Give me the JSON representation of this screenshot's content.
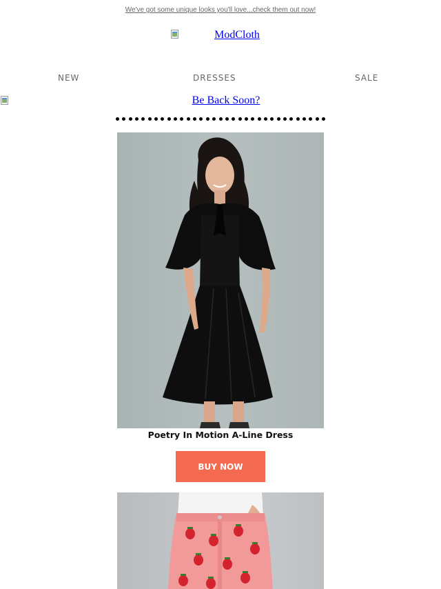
{
  "preheader": {
    "text": "We've got some unique looks you'll love...check them out now!"
  },
  "logo": {
    "alt": "ModCloth"
  },
  "nav": {
    "items": [
      {
        "label": "NEW"
      },
      {
        "label": "DRESSES"
      },
      {
        "label": "SALE"
      }
    ]
  },
  "banner": {
    "alt": "Be Back Soon?"
  },
  "products": [
    {
      "name": "Poetry In Motion A-Line Dress",
      "cta": "BUY NOW"
    }
  ],
  "colors": {
    "cta_background": "#f46a50",
    "cta_text": "#ffffff",
    "link": "#0000ee",
    "nav_text": "#666666"
  }
}
